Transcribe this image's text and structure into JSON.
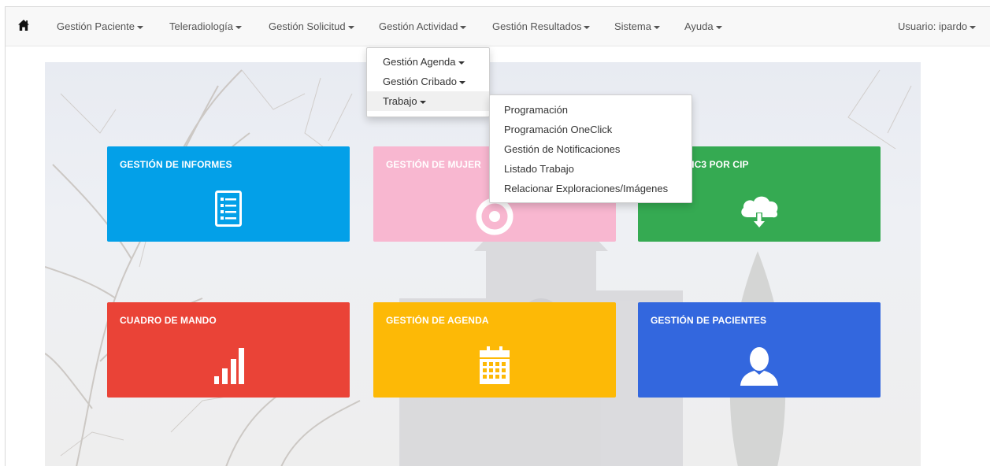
{
  "navbar": {
    "items": [
      {
        "label": "Gestión Paciente"
      },
      {
        "label": "Teleradiología"
      },
      {
        "label": "Gestión Solicitud"
      },
      {
        "label": "Gestión Actividad"
      },
      {
        "label": "Gestión Resultados"
      },
      {
        "label": "Sistema"
      },
      {
        "label": "Ayuda"
      }
    ],
    "user": "Usuario: ipardo"
  },
  "menu_actividad": {
    "items": [
      {
        "label": "Gestión Agenda"
      },
      {
        "label": "Gestión Cribado"
      },
      {
        "label": "Trabajo"
      }
    ]
  },
  "menu_trabajo": {
    "items": [
      {
        "label": "Programación"
      },
      {
        "label": "Programación OneClick"
      },
      {
        "label": "Gestión de Notificaciones"
      },
      {
        "label": "Listado Trabajo"
      },
      {
        "label": "Relacionar Exploraciones/Imágenes"
      }
    ]
  },
  "tiles": [
    {
      "title": "GESTIÓN DE INFORMES",
      "icon": "list-icon",
      "color": "#03a0e8"
    },
    {
      "title": "GESTIÓN DE MUJER",
      "icon": "target-icon",
      "color": "#f8b7d0"
    },
    {
      "title": "LTA HC3 POR CIP",
      "icon": "cloud-download-icon",
      "color": "#35aa52"
    },
    {
      "title": "CUADRO DE MANDO",
      "icon": "bar-chart-icon",
      "color": "#ea4337"
    },
    {
      "title": "GESTIÓN DE AGENDA",
      "icon": "calendar-icon",
      "color": "#fdb906"
    },
    {
      "title": "GESTIÓN DE PACIENTES",
      "icon": "user-icon",
      "color": "#3367de"
    }
  ],
  "colors": {
    "navbar_bg": "#f8f8f8",
    "menu_hover": "#f0f0f0"
  }
}
